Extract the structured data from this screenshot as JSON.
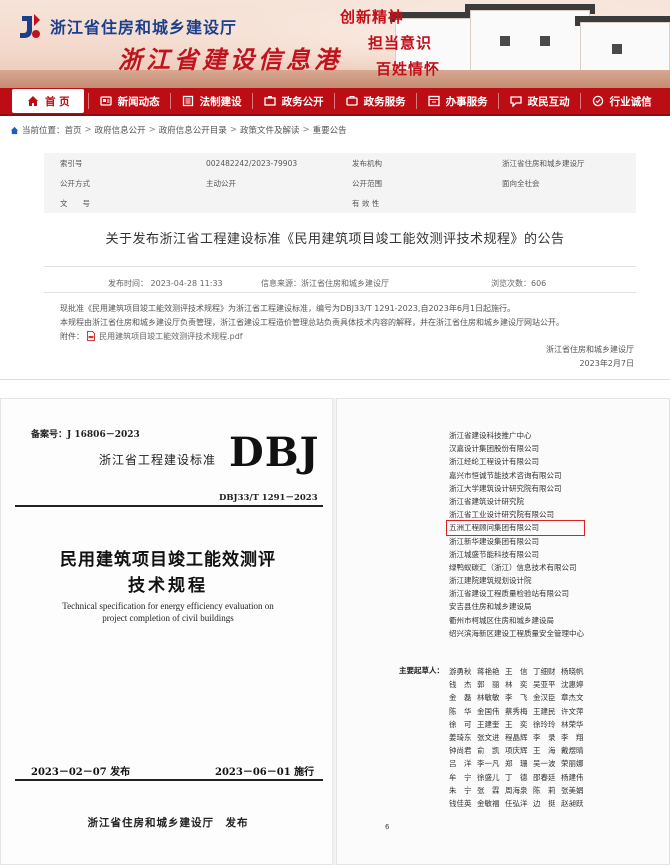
{
  "site": {
    "title": "浙江省住房和城乡建设厅",
    "subtitle": "浙江省建设信息港",
    "slogans": [
      "创新精神",
      "担当意识",
      "百姓情怀"
    ]
  },
  "nav": {
    "items": [
      {
        "label": "首 页",
        "icon": "home-icon"
      },
      {
        "label": "新闻动态",
        "icon": "news-icon"
      },
      {
        "label": "法制建设",
        "icon": "law-icon"
      },
      {
        "label": "政务公开",
        "icon": "gov-icon"
      },
      {
        "label": "政务服务",
        "icon": "service-icon"
      },
      {
        "label": "办事服务",
        "icon": "office-icon"
      },
      {
        "label": "政民互动",
        "icon": "interact-icon"
      },
      {
        "label": "行业诚信",
        "icon": "credit-icon"
      }
    ]
  },
  "breadcrumb": {
    "prefix": "当前位置：",
    "items": [
      "首页",
      "政府信息公开",
      "政府信息公开目录",
      "政策文件及解读",
      "重要公告"
    ]
  },
  "meta": {
    "rows": [
      {
        "l1": "索引号",
        "v1": "002482242/2023-79903",
        "l2": "发布机构",
        "v2": "浙江省住房和城乡建设厅"
      },
      {
        "l1": "公开方式",
        "v1": "主动公开",
        "l2": "公开范围",
        "v2": "面向全社会"
      },
      {
        "l1": "文　　号",
        "v1": "",
        "l2": "有 效 性",
        "v2": ""
      }
    ]
  },
  "article": {
    "title": "关于发布浙江省工程建设标准《民用建筑项目竣工能效测评技术规程》的公告",
    "date": "发布时间：  2023-04-28 11:33",
    "source": "信息来源：浙江省住房和城乡建设厅",
    "views": "浏览次数：606",
    "paragraph1": "现批准《民用建筑项目竣工能效测评技术规程》为浙江省工程建设标准，编号为DBJ33/T 1291-2023,自2023年6月1日起施行。",
    "paragraph2": "本规程由浙江省住房和城乡建设厅负责管理，浙江省建设工程造价管理总站负责具体技术内容的解释，并在浙江省住房和城乡建设厅网站公开。",
    "attachment_label": "附件：",
    "attachment_name": "民用建筑项目竣工能效测评技术规程.pdf",
    "sign_org": "浙江省住房和城乡建设厅",
    "sign_date": "2023年2月7日"
  },
  "doc_left": {
    "record_no": "备案号：J 16806－2023",
    "std_type": "浙江省工程建设标准",
    "logo": "DBJ",
    "std_code": "DBJ33/T 1291－2023",
    "title_line1": "民用建筑项目竣工能效测评",
    "title_line2": "技术规程",
    "en_line1": "Technical specification for energy efficiency evaluation on",
    "en_line2": "project completion of civil buildings",
    "issue_date": "2023－02－07 发布",
    "impl_date": "2023－06－01 施行",
    "publisher": "浙江省住房和城乡建设厅　发布"
  },
  "doc_right": {
    "orgs": [
      "浙江省建设科技推广中心",
      "汉嘉设计集团股份有限公司",
      "浙江经纶工程设计有限公司",
      "嘉兴市恒诚节能技术咨询有限公司",
      "浙江大学建筑设计研究院有限公司",
      "浙江省建筑设计研究院",
      "浙江省工业设计研究院有限公司",
      "五洲工程顾问集团有限公司",
      "浙江新华建设集团有限公司",
      "浙江城盛节能科技有限公司",
      "绿鸭蚁碳汇（浙江）信息技术有限公司",
      "浙江建院建筑规划设计院",
      "浙江省建设工程质量检验站有限公司",
      "安吉县住房和城乡建设局",
      "衢州市柯城区住房和城乡建设局",
      "绍兴滨海新区建设工程质量安全管理中心"
    ],
    "highlighted_index": 7,
    "drafter_label": "主要起草人：",
    "names": [
      [
        "游勇秋",
        "蒋艳艳",
        "王　信",
        "丁细财",
        "杨晓帆"
      ],
      [
        "钱　杰",
        "郭　丽",
        "林　奕",
        "吴亚平",
        "沈惠婷"
      ],
      [
        "金　磊",
        "林敏敏",
        "李　飞",
        "金汉臣",
        "章杰文"
      ],
      [
        "陈　华",
        "金国伟",
        "蔡秀梅",
        "王建民",
        "许文萍"
      ],
      [
        "徐　可",
        "王建奎",
        "王　奕",
        "徐玲玲",
        "林荣华"
      ],
      [
        "姜琦东",
        "张文进",
        "程晶辉",
        "李　录",
        "李　翔"
      ],
      [
        "钟尚君",
        "俞　凯",
        "项庆辉",
        "王　海",
        "戴煜晴"
      ],
      [
        "吕　洋",
        "李一凡",
        "郑　珊",
        "吴一波",
        "荣丽娜"
      ],
      [
        "牟　宁",
        "徐盛儿",
        "丁　德",
        "邵春廷",
        "杨建伟"
      ],
      [
        "朱　宁",
        "张　霖",
        "周海泉",
        "陈　莉",
        "张美娟"
      ],
      [
        "钱佳英",
        "金敏福",
        "任弘洋",
        "边　挺",
        "赵昶跃"
      ]
    ],
    "page_num": "6"
  },
  "colors": {
    "nav_red": "#bd0d14",
    "title_blue": "#1c3f8c",
    "slogan_red": "#c3101a",
    "highlight_red": "#e02020"
  }
}
